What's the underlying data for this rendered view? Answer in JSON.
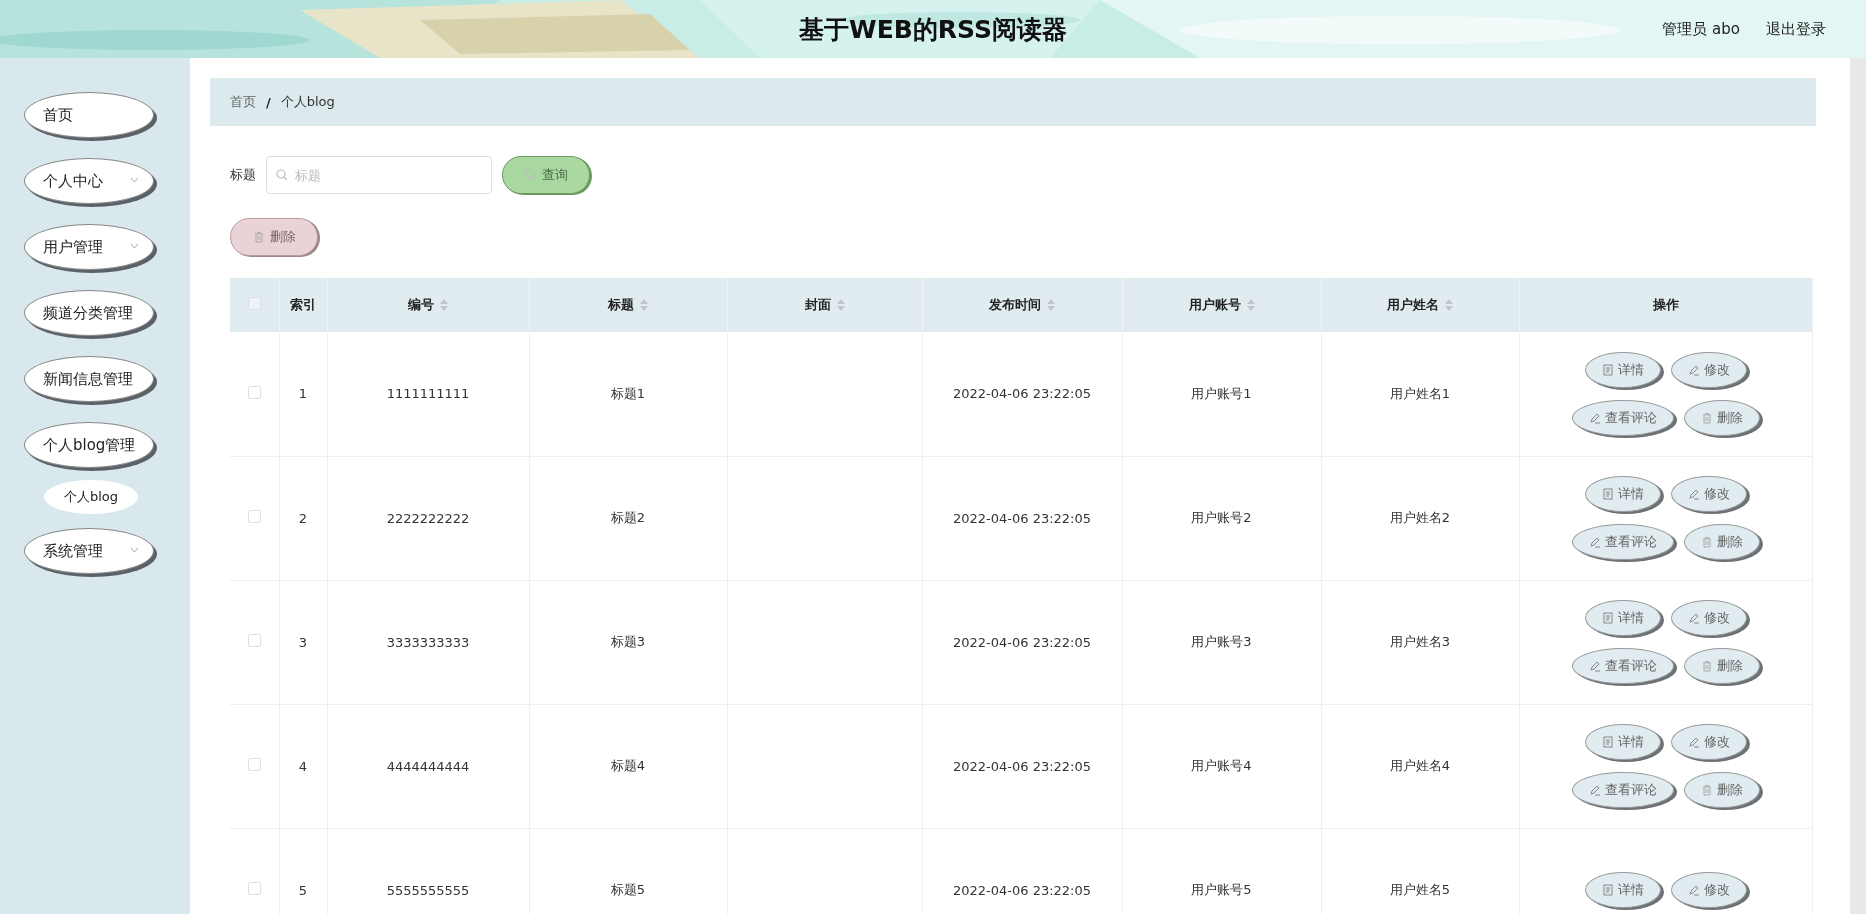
{
  "header": {
    "title": "基于WEB的RSS阅读器",
    "user": "管理员 abo",
    "logout": "退出登录"
  },
  "sidebar": {
    "items": [
      {
        "label": "首页",
        "expandable": false
      },
      {
        "label": "个人中心",
        "expandable": true
      },
      {
        "label": "用户管理",
        "expandable": true
      },
      {
        "label": "频道分类管理",
        "expandable": false
      },
      {
        "label": "新闻信息管理",
        "expandable": false
      },
      {
        "label": "个人blog管理",
        "expandable": false,
        "children": [
          {
            "label": "个人blog"
          }
        ]
      },
      {
        "label": "系统管理",
        "expandable": true
      }
    ]
  },
  "breadcrumb": {
    "items": [
      "首页",
      "个人blog"
    ],
    "separator": "/"
  },
  "search": {
    "label": "标题",
    "placeholder": "标题",
    "button": "查询"
  },
  "delete_button": "删除",
  "table": {
    "all_checked": false,
    "columns": [
      {
        "label": "索引",
        "sortable": false
      },
      {
        "label": "编号",
        "sortable": true
      },
      {
        "label": "标题",
        "sortable": true
      },
      {
        "label": "封面",
        "sortable": true
      },
      {
        "label": "发布时间",
        "sortable": true
      },
      {
        "label": "用户账号",
        "sortable": true
      },
      {
        "label": "用户姓名",
        "sortable": true
      },
      {
        "label": "操作",
        "sortable": false
      }
    ],
    "rows": [
      {
        "checked": false,
        "cells": [
          "1",
          "1111111111",
          "标题1",
          "",
          "2022-04-06 23:22:05",
          "用户账号1",
          "用户姓名1"
        ],
        "actions": [
          "详情",
          "修改",
          "查看评论",
          "删除"
        ]
      },
      {
        "checked": false,
        "cells": [
          "2",
          "2222222222",
          "标题2",
          "",
          "2022-04-06 23:22:05",
          "用户账号2",
          "用户姓名2"
        ],
        "actions": [
          "详情",
          "修改",
          "查看评论",
          "删除"
        ]
      },
      {
        "checked": false,
        "cells": [
          "3",
          "3333333333",
          "标题3",
          "",
          "2022-04-06 23:22:05",
          "用户账号3",
          "用户姓名3"
        ],
        "actions": [
          "详情",
          "修改",
          "查看评论",
          "删除"
        ]
      },
      {
        "checked": false,
        "cells": [
          "4",
          "4444444444",
          "标题4",
          "",
          "2022-04-06 23:22:05",
          "用户账号4",
          "用户姓名4"
        ],
        "actions": [
          "详情",
          "修改",
          "查看评论",
          "删除"
        ]
      },
      {
        "checked": false,
        "cells": [
          "5",
          "5555555555",
          "标题5",
          "",
          "2022-04-06 23:22:05",
          "用户账号5",
          "用户姓名5"
        ],
        "actions": [
          "详情",
          "修改"
        ]
      }
    ]
  }
}
